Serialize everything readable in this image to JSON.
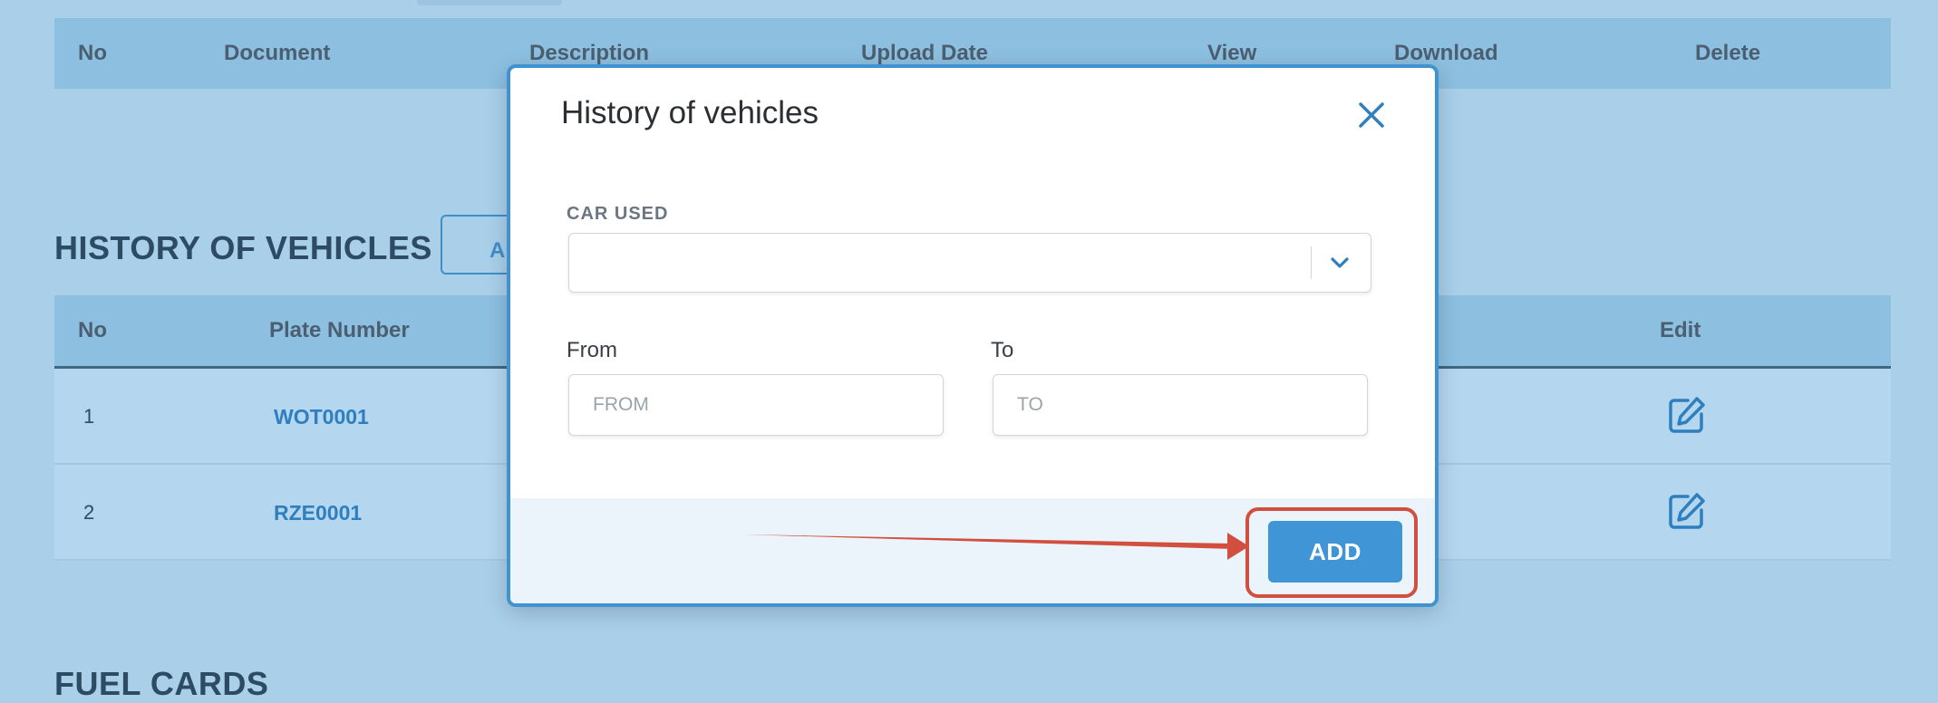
{
  "documents_table": {
    "columns": [
      "No",
      "Document",
      "Description",
      "Upload Date",
      "View",
      "Download",
      "Delete"
    ]
  },
  "history_section": {
    "title": "HISTORY OF VEHICLES",
    "add_button_partial": "A",
    "columns": [
      "No",
      "Plate Number",
      "Edit"
    ],
    "rows": [
      {
        "no": "1",
        "plate": "WOT0001"
      },
      {
        "no": "2",
        "plate": "RZE0001"
      }
    ]
  },
  "fuel_section": {
    "title": "FUEL CARDS"
  },
  "modal": {
    "title": "History of vehicles",
    "car_used_label": "CAR USED",
    "car_used_value": "",
    "from_label": "From",
    "from_placeholder": "FROM",
    "to_label": "To",
    "to_placeholder": "TO",
    "add_label": "ADD"
  },
  "icons": {
    "close": "close-icon",
    "chevron": "chevron-down-icon",
    "edit": "edit-icon"
  },
  "colors": {
    "page_background": "#a9cfe9",
    "table_header": "#8dbfe0",
    "accent": "#3f95d5",
    "annotation": "#d24e3f"
  }
}
